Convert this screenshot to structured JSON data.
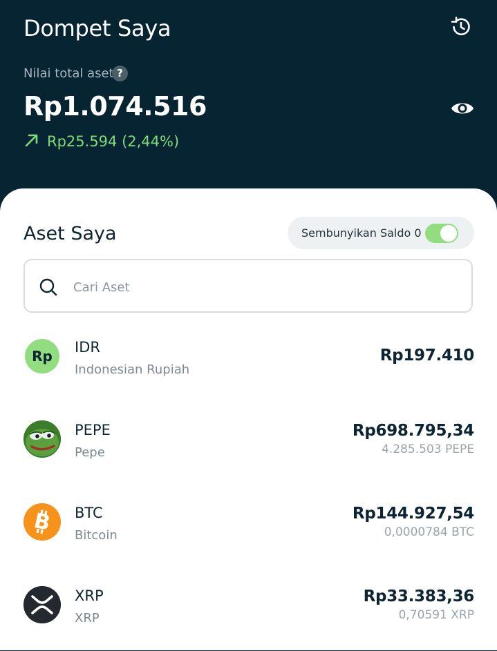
{
  "header": {
    "title": "Dompet Saya",
    "total_label": "Nilai total aset",
    "help_icon_label": "?",
    "total_value": "Rp1.074.516",
    "change_text": "Rp25.594 (2,44%)",
    "change_color": "#7fdb7a",
    "icons": [
      "history-icon",
      "help-icon",
      "eye-icon",
      "arrow-up-right-icon"
    ]
  },
  "assets_section": {
    "title": "Aset Saya",
    "hide_balance_label": "Sembunyikan Saldo 0",
    "hide_balance_on": true,
    "search_placeholder": "Cari Aset"
  },
  "assets": [
    {
      "symbol": "IDR",
      "name": "Indonesian Rupiah",
      "value": "Rp197.410",
      "amount": "",
      "icon": "rupiah-icon",
      "icon_text": "Rp",
      "color": "#92dd7f"
    },
    {
      "symbol": "PEPE",
      "name": "Pepe",
      "value": "Rp698.795,34",
      "amount": "4.285.503 PEPE",
      "icon": "pepe-frog-icon",
      "color": "#3f8a2e"
    },
    {
      "symbol": "BTC",
      "name": "Bitcoin",
      "value": "Rp144.927,54",
      "amount": "0,0000784 BTC",
      "icon": "bitcoin-icon",
      "color": "#f7931a"
    },
    {
      "symbol": "XRP",
      "name": "XRP",
      "value": "Rp33.383,36",
      "amount": "0,70591 XRP",
      "icon": "xrp-icon",
      "color": "#23292f"
    }
  ]
}
